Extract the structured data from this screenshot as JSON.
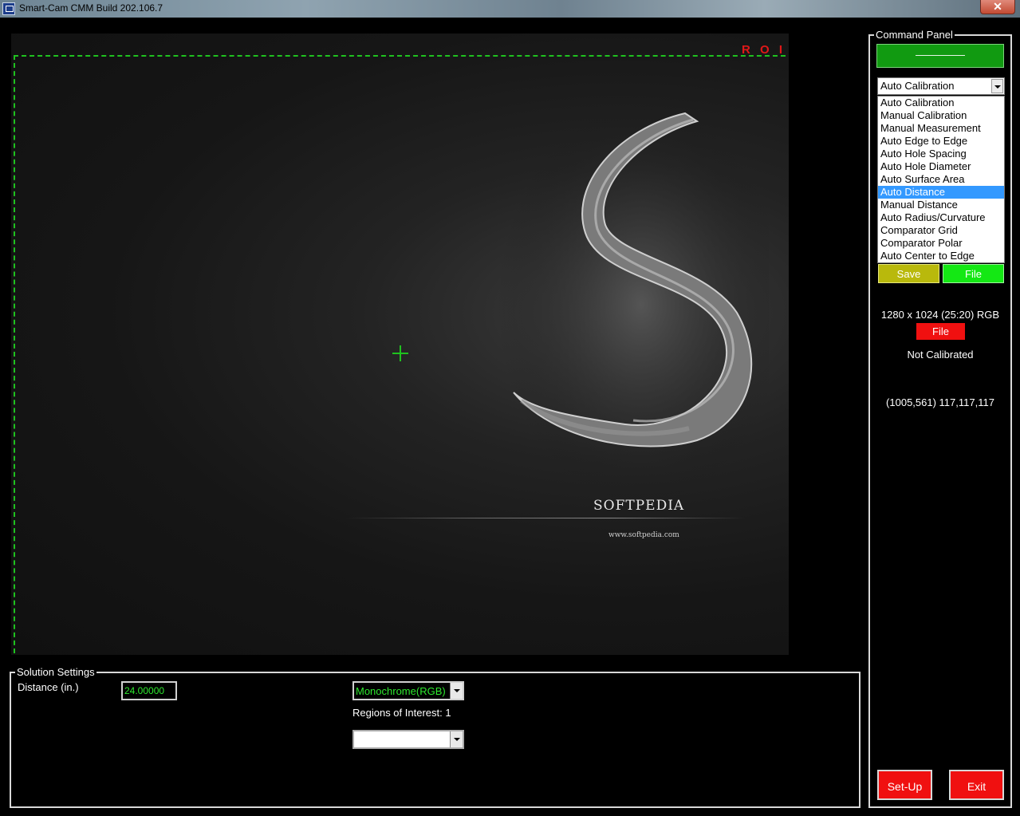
{
  "window": {
    "title": "Smart-Cam CMM Build 202.106.7",
    "close_label": "✕"
  },
  "viewport": {
    "roi_label": "R O I",
    "watermark_logo": "SOFTPEDIA",
    "watermark_url": "www.softpedia.com"
  },
  "solution_settings": {
    "title": "Solution Settings",
    "distance_label": "Distance (in.)",
    "distance_value": "24.00000",
    "color_mode": "Monochrome(RGB)",
    "regions_text": "Regions of Interest: 1",
    "roi_select_value": ""
  },
  "command_panel": {
    "title": "Command Panel",
    "mode_selected": "Auto Calibration",
    "modes": [
      "Auto Calibration",
      "Manual Calibration",
      "Manual Measurement",
      "Auto Edge to Edge",
      "Auto Hole Spacing",
      "Auto Hole Diameter",
      "Auto Surface Area",
      "Auto Distance",
      "Manual Distance",
      "Auto Radius/Curvature",
      "Comparator Grid",
      "Comparator Polar",
      "Auto Center to Edge"
    ],
    "highlighted_mode": "Auto Distance",
    "save_label": "Save",
    "file_label": "File",
    "resolution": "1280 x 1024 (25:20) RGB",
    "file_red_label": "File",
    "calibration_status": "Not Calibrated",
    "pixel_readout": "(1005,561) 117,117,117",
    "setup_label": "Set-Up",
    "exit_label": "Exit"
  },
  "colors": {
    "roi_green": "#1fc21f",
    "alert_red": "#f01010",
    "highlight_blue": "#3399ff"
  }
}
